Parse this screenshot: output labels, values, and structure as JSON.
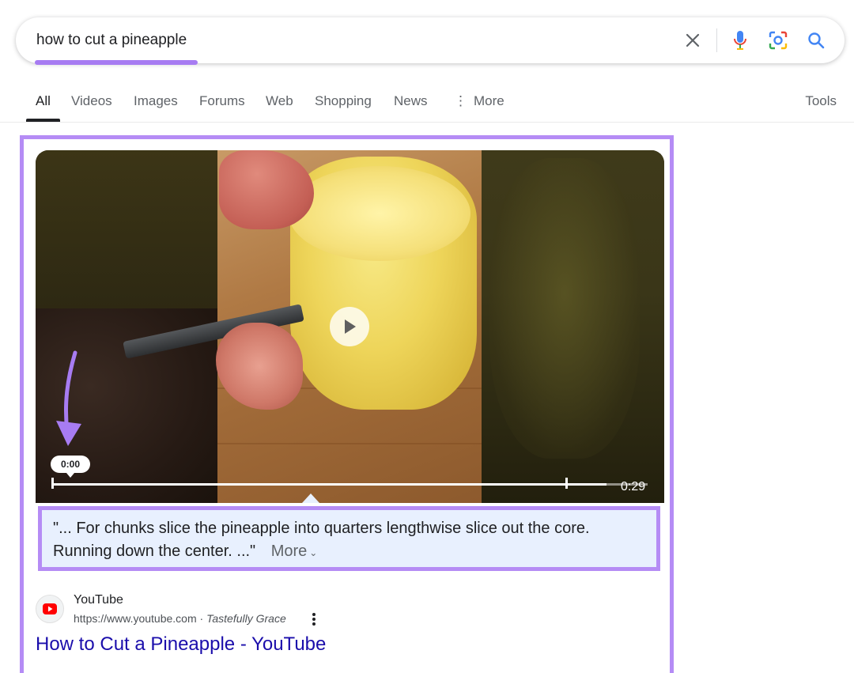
{
  "search": {
    "query": "how to cut a pineapple",
    "icons": [
      "close-icon",
      "microphone-icon",
      "lens-icon",
      "search-icon"
    ]
  },
  "tabs": [
    {
      "label": "All",
      "active": true
    },
    {
      "label": "Videos"
    },
    {
      "label": "Images"
    },
    {
      "label": "Forums"
    },
    {
      "label": "Web"
    },
    {
      "label": "Shopping"
    },
    {
      "label": "News"
    },
    {
      "label": "More"
    }
  ],
  "tools_label": "Tools",
  "highlight_color": "#b58cf5",
  "video": {
    "current_time": "0:00",
    "duration": "0:29",
    "progress_fraction": 0.0
  },
  "caption": {
    "text": "\"... For chunks slice the pineapple into quarters lengthwise slice out the core. Running down the center. ...\"",
    "more_label": "More"
  },
  "result": {
    "site_name": "YouTube",
    "url": "https://www.youtube.com",
    "author": "Tastefully Grace",
    "title": "How to Cut a Pineapple - YouTube"
  }
}
